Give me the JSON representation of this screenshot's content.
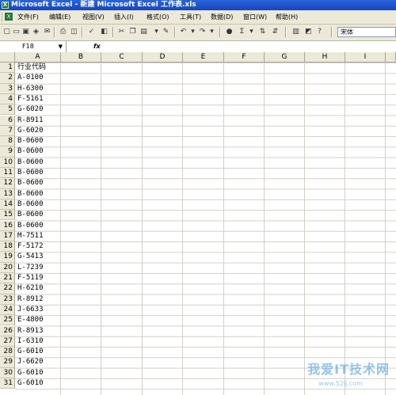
{
  "window": {
    "title": "Microsoft Excel - 新建 Microsoft Excel 工作表.xls"
  },
  "menu": [
    "文件(F)",
    "编辑(E)",
    "视图(V)",
    "插入(I)",
    "格式(O)",
    "工具(T)",
    "数据(D)",
    "窗口(W)",
    "帮助(H)"
  ],
  "toolbar": {
    "font_name": "宋体",
    "icons": [
      "new-icon",
      "open-icon",
      "save-icon",
      "permission-icon",
      "email-icon",
      "print-icon",
      "print-preview-icon",
      "spelling-icon",
      "research-icon",
      "cut-icon",
      "copy-icon",
      "paste-icon",
      "format-painter-icon",
      "undo-icon",
      "redo-icon",
      "hyperlink-icon",
      "autosum-icon",
      "sort-ascending-icon",
      "sort-descending-icon",
      "chart-icon",
      "help-icon"
    ],
    "autosum_glyph": "Σ"
  },
  "formula_bar": {
    "name_box": "F18",
    "fx_label": "fx",
    "value": ""
  },
  "columns": [
    "A",
    "B",
    "C",
    "D",
    "E",
    "F",
    "G",
    "H",
    "I"
  ],
  "rows": [
    {
      "n": "1",
      "a": "行业代码"
    },
    {
      "n": "2",
      "a": "A-0100"
    },
    {
      "n": "3",
      "a": "H-6300"
    },
    {
      "n": "4",
      "a": "F-5161"
    },
    {
      "n": "5",
      "a": "G-6020"
    },
    {
      "n": "6",
      "a": "R-8911"
    },
    {
      "n": "7",
      "a": "G-6020"
    },
    {
      "n": "8",
      "a": "B-0600"
    },
    {
      "n": "9",
      "a": "B-0600"
    },
    {
      "n": "10",
      "a": "B-0600"
    },
    {
      "n": "11",
      "a": "B-0600"
    },
    {
      "n": "12",
      "a": "B-0600"
    },
    {
      "n": "13",
      "a": "B-0600"
    },
    {
      "n": "14",
      "a": "B-0600"
    },
    {
      "n": "15",
      "a": "B-0600"
    },
    {
      "n": "16",
      "a": "B-0600"
    },
    {
      "n": "17",
      "a": "M-7511"
    },
    {
      "n": "18",
      "a": "F-5172"
    },
    {
      "n": "19",
      "a": "G-5413"
    },
    {
      "n": "20",
      "a": "L-7239"
    },
    {
      "n": "21",
      "a": "F-5119"
    },
    {
      "n": "22",
      "a": "H-6210"
    },
    {
      "n": "23",
      "a": "R-8912"
    },
    {
      "n": "24",
      "a": "J-6633"
    },
    {
      "n": "25",
      "a": "E-4800"
    },
    {
      "n": "26",
      "a": "R-8913"
    },
    {
      "n": "27",
      "a": "I-6310"
    },
    {
      "n": "28",
      "a": "G-6010"
    },
    {
      "n": "29",
      "a": "J-6620"
    },
    {
      "n": "30",
      "a": "G-6010"
    },
    {
      "n": "31",
      "a": "G-6010"
    }
  ],
  "watermark": {
    "text": "我爱IT技术网",
    "url": "www.52ij.com"
  }
}
